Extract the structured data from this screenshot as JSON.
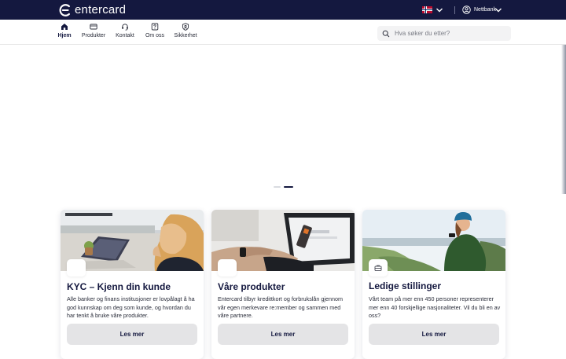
{
  "header": {
    "brand": "entercard",
    "language_flag": "norway-flag-icon",
    "netbank_label": "Nettbank"
  },
  "nav": {
    "items": [
      {
        "label": "Hjem",
        "icon": "home-icon",
        "active": true
      },
      {
        "label": "Produkter",
        "icon": "card-icon",
        "active": false
      },
      {
        "label": "Kontakt",
        "icon": "headset-icon",
        "active": false
      },
      {
        "label": "Om oss",
        "icon": "question-icon",
        "active": false
      },
      {
        "label": "Sikkerhet",
        "icon": "shield-icon",
        "active": false
      }
    ],
    "search_placeholder": "Hva søker du etter?"
  },
  "carousel": {
    "slides": 2,
    "active_index": 1
  },
  "cards": [
    {
      "title": "KYC – Kjenn din kunde",
      "text": "Alle banker og finans institusjoner er lovpålagt å ha god kunnskap om deg som kunde, og hvordan du har tenkt å bruke våre produkter.",
      "button": "Les mer",
      "image": "woman-with-laptop-photo"
    },
    {
      "title": "Våre produkter",
      "text": "Entercard tilbyr kredittkort og forbrukslån gjennom vår egen merkevare re:member og sammen med våre partnere.",
      "button": "Les mer",
      "image": "laptop-payment-photo"
    },
    {
      "title": "Ledige stillinger",
      "text": "Vårt team på mer enn 450 personer representerer mer enn 40 forskjellige nasjonaliteter. Vil du bli en av oss?",
      "button": "Les mer",
      "image": "woman-on-coast-photo",
      "icon": "briefcase-icon"
    }
  ],
  "colors": {
    "brand_navy": "#14183f",
    "button_grey": "#e4e4e6",
    "flag_red": "#ba0c2f"
  }
}
